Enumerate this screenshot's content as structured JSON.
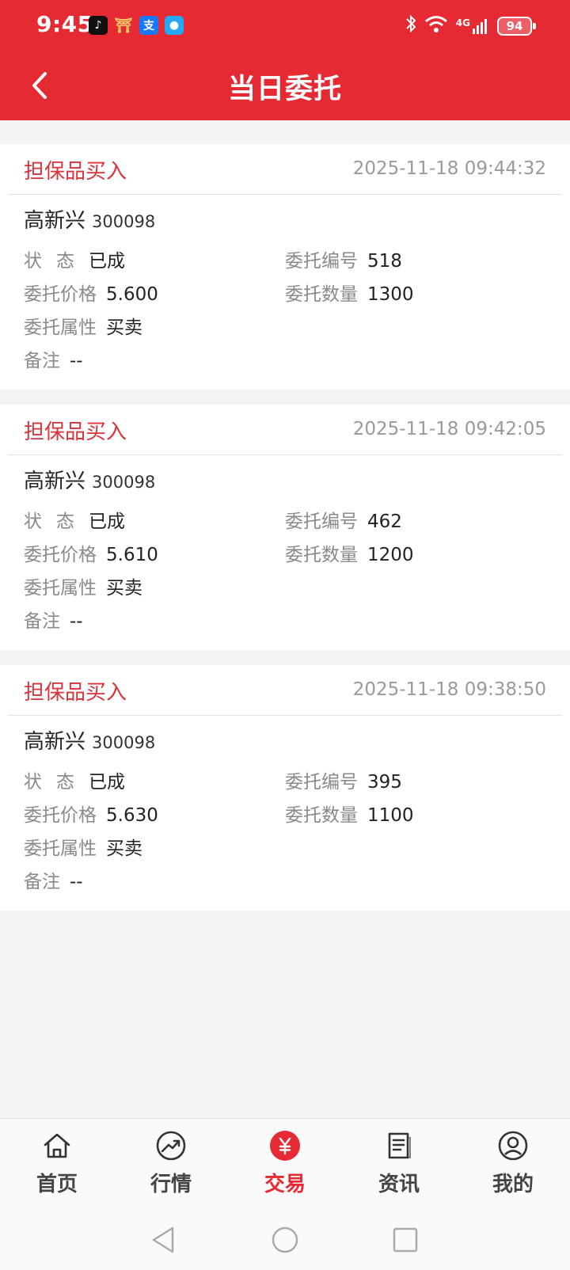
{
  "status_bar": {
    "time": "9:45",
    "network": "4G",
    "battery": "94",
    "notification_icons": [
      "tiktok-icon",
      "bank-app-icon",
      "alipay-icon",
      "message-icon"
    ]
  },
  "header": {
    "title": "当日委托",
    "back_icon": "chevron-left-icon",
    "background_color": "#e62a33"
  },
  "labels": {
    "status": "状态",
    "order_no": "委托编号",
    "price": "委托价格",
    "quantity": "委托数量",
    "attribute": "委托属性",
    "remark": "备注"
  },
  "orders": [
    {
      "type": "担保品买入",
      "time": "2025-11-18 09:44:32",
      "stock_name": "高新兴",
      "stock_code": "300098",
      "status": "已成",
      "order_no": "518",
      "price": "5.600",
      "quantity": "1300",
      "attribute": "买卖",
      "remark": "--"
    },
    {
      "type": "担保品买入",
      "time": "2025-11-18 09:42:05",
      "stock_name": "高新兴",
      "stock_code": "300098",
      "status": "已成",
      "order_no": "462",
      "price": "5.610",
      "quantity": "1200",
      "attribute": "买卖",
      "remark": "--"
    },
    {
      "type": "担保品买入",
      "time": "2025-11-18 09:38:50",
      "stock_name": "高新兴",
      "stock_code": "300098",
      "status": "已成",
      "order_no": "395",
      "price": "5.630",
      "quantity": "1100",
      "attribute": "买卖",
      "remark": "--"
    }
  ],
  "tabbar": {
    "items": [
      {
        "label": "首页",
        "icon": "home-icon"
      },
      {
        "label": "行情",
        "icon": "trend-chart-icon"
      },
      {
        "label": "交易",
        "icon": "yuan-coin-icon",
        "active": true
      },
      {
        "label": "资讯",
        "icon": "news-icon"
      },
      {
        "label": "我的",
        "icon": "user-icon"
      }
    ],
    "active_color": "#e62a33"
  },
  "system_nav": [
    "back-triangle-icon",
    "home-circle-icon",
    "recents-square-icon"
  ]
}
